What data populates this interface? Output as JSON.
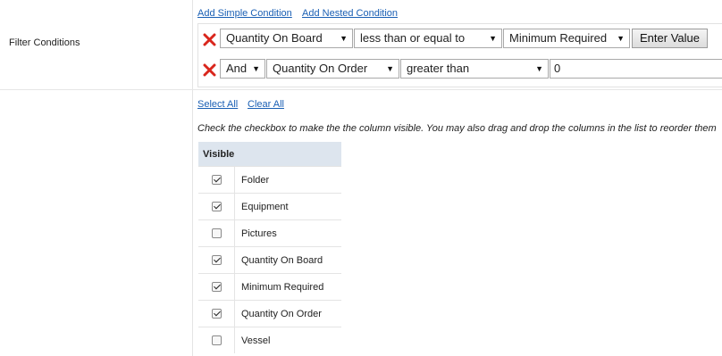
{
  "filter": {
    "label": "Filter Conditions",
    "add_simple": "Add Simple Condition",
    "add_nested": "Add Nested Condition",
    "row1": {
      "field": "Quantity On Board",
      "operator": "less than or equal to",
      "value_field": "Minimum Required",
      "enter_value": "Enter Value"
    },
    "row2": {
      "conjunction": "And",
      "field": "Quantity On Order",
      "operator": "greater than",
      "value": "0"
    }
  },
  "columns": {
    "select_all": "Select All",
    "clear_all": "Clear All",
    "help": "Check the checkbox to make the the column visible. You may also drag and drop the columns in the list to reorder them",
    "header": "Visible",
    "items": [
      {
        "label": "Folder",
        "checked": true
      },
      {
        "label": "Equipment",
        "checked": true
      },
      {
        "label": "Pictures",
        "checked": false
      },
      {
        "label": "Quantity On Board",
        "checked": true
      },
      {
        "label": "Minimum Required",
        "checked": true
      },
      {
        "label": "Quantity On Order",
        "checked": true
      },
      {
        "label": "Vessel",
        "checked": false
      }
    ]
  },
  "colors": {
    "link": "#1a5fb4",
    "header_bg": "#dde5ee",
    "remove_icon": "#d9261c"
  }
}
